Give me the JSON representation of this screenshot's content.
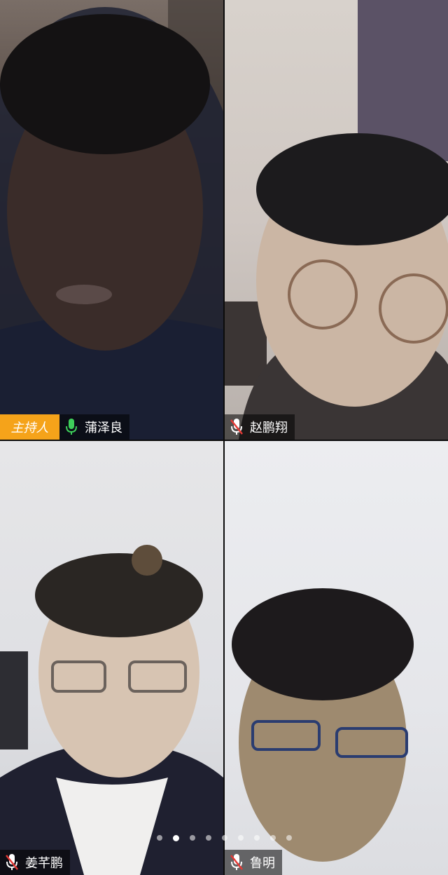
{
  "participants": [
    {
      "name": "蒲泽良",
      "role_badge": "主持人",
      "mic": "on"
    },
    {
      "name": "赵鹏翔",
      "mic": "muted"
    },
    {
      "name": "姜芊鹏",
      "mic": "muted"
    },
    {
      "name": "鲁明",
      "mic": "muted"
    }
  ],
  "pager": {
    "total": 9,
    "active_index": 1
  },
  "colors": {
    "host_badge": "#f5a31a",
    "mic_on": "#3ecf5a",
    "mic_muted": "#e53935",
    "label_bg": "rgba(0,0,0,0.55)"
  }
}
